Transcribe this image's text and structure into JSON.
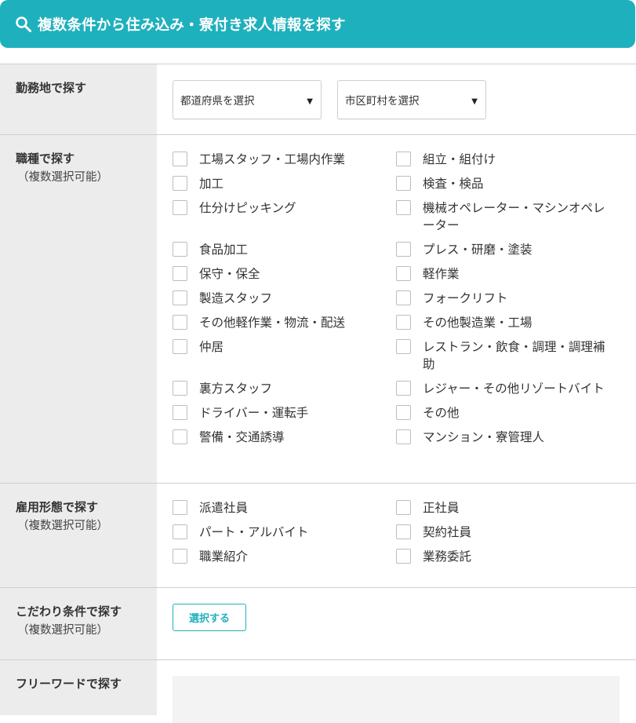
{
  "header": {
    "title": "複数条件から住み込み・寮付き求人情報を探す",
    "icon": "search-icon",
    "background": "#1fb0bd"
  },
  "location": {
    "label": "勤務地で探す",
    "prefecture": "都道府県を選択",
    "city": "市区町村を選択"
  },
  "job_type": {
    "label": "職種で探す",
    "sub": "（複数選択可能）",
    "options": [
      "工場スタッフ・工場内作業",
      "組立・組付け",
      "加工",
      "検査・検品",
      "仕分けピッキング",
      "機械オペレーター・マシンオペレーター",
      "食品加工",
      "プレス・研磨・塗装",
      "保守・保全",
      "軽作業",
      "製造スタッフ",
      "フォークリフト",
      "その他軽作業・物流・配送",
      "その他製造業・工場",
      "仲居",
      "レストラン・飲食・調理・調理補助",
      "裏方スタッフ",
      "レジャー・その他リゾートバイト",
      "ドライバー・運転手",
      "その他",
      "警備・交通誘導",
      "マンション・寮管理人"
    ]
  },
  "employment": {
    "label": "雇用形態で探す",
    "sub": "（複数選択可能）",
    "options": [
      "派遣社員",
      "正社員",
      "パート・アルバイト",
      "契約社員",
      "職業紹介",
      "業務委託"
    ]
  },
  "conditions": {
    "label": "こだわり条件で探す",
    "sub": "（複数選択可能）",
    "button": "選択する"
  },
  "freeword": {
    "label": "フリーワードで探す"
  }
}
